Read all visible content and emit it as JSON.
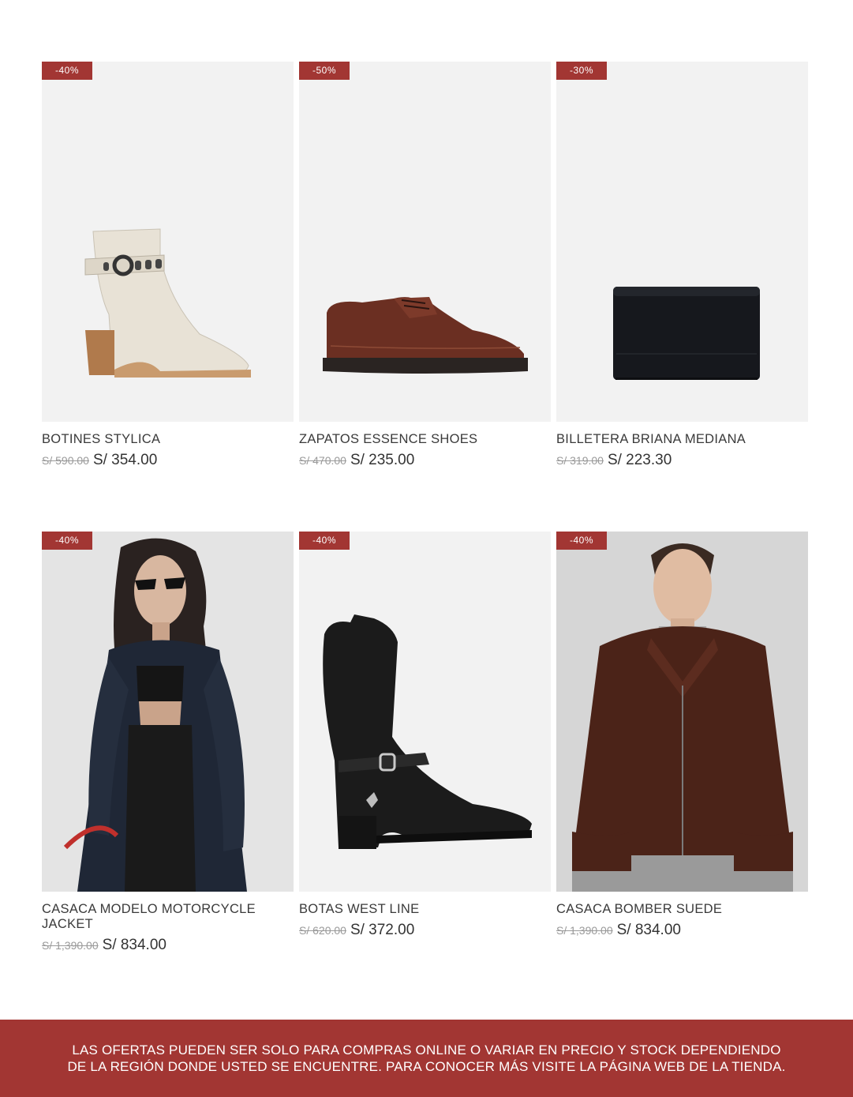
{
  "products": [
    {
      "badge": "-40%",
      "name": "BOTINES STYLICA",
      "old_price": "S/ 590.00",
      "price": "S/ 354.00",
      "image": "white-heeled-ankle-boot"
    },
    {
      "badge": "-50%",
      "name": "ZAPATOS ESSENCE SHOES",
      "old_price": "S/ 470.00",
      "price": "S/ 235.00",
      "image": "brown-leather-derby-shoe"
    },
    {
      "badge": "-30%",
      "name": "BILLETERA BRIANA MEDIANA",
      "old_price": "S/ 319.00",
      "price": "S/ 223.30",
      "image": "black-wallet"
    },
    {
      "badge": "-40%",
      "name": "CASACA MODELO MOTORCYCLE JACKET",
      "old_price": "S/ 1,390.00",
      "price": "S/ 834.00",
      "image": "woman-in-leather-motorcycle-jacket"
    },
    {
      "badge": "-40%",
      "name": "BOTAS WEST LINE",
      "old_price": "S/ 620.00",
      "price": "S/ 372.00",
      "image": "black-western-boot"
    },
    {
      "badge": "-40%",
      "name": "CASACA BOMBER SUEDE",
      "old_price": "S/ 1,390.00",
      "price": "S/ 834.00",
      "image": "man-in-brown-suede-bomber"
    }
  ],
  "footer": {
    "line1": "LAS OFERTAS PUEDEN SER SOLO PARA COMPRAS ONLINE O VARIAR EN PRECIO Y STOCK DEPENDIENDO",
    "line2": "DE LA REGIÓN DONDE USTED SE ENCUENTRE. PARA CONOCER MÁS VISITE LA PÁGINA WEB DE LA TIENDA."
  },
  "colors": {
    "accent": "#a23633",
    "image_bg": "#f2f2f2"
  }
}
